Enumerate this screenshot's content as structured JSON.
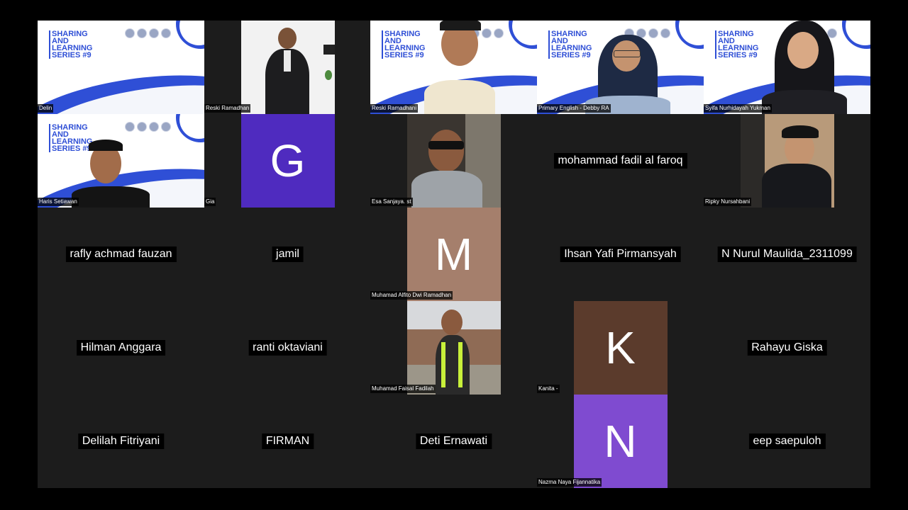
{
  "slide": {
    "title": "SHARING\nAND\nLEARNING\nSERIES #9"
  },
  "tiles": {
    "delin": "Delin",
    "reski_suit": "Reski Ramadhan",
    "reski_slide": "Reski Ramadhani",
    "debby": "Primary English - Debby RA",
    "syifa": "Syifa Nurhidayah Yukman",
    "haris": "Haris Setiawan",
    "gia": "Gia",
    "gia_avatar": "G",
    "esa": "Esa Sanjaya. st",
    "fadil": "mohammad fadil al faroq",
    "ripky": "Ripky Nursahbani",
    "rafly": "rafly achmad fauzan",
    "jamil": "jamil",
    "alfito": "Muhamad Alfito Dwi Ramadhan",
    "alfito_avatar": "M",
    "ihsan": "Ihsan Yafi Pirmansyah",
    "nurul": "N Nurul Maulida_2311099",
    "hilman": "Hilman Anggara",
    "ranti": "ranti oktaviani",
    "faisal": "Muhamad Faisal Fadilah",
    "kanita": "Kanita -",
    "kanita_avatar": "K",
    "rahayu": "Rahayu Giska",
    "delilah": "Delilah Fitriyani",
    "firman": "FIRMAN",
    "deti": "Deti Ernawati",
    "nazma": "Nazma Naya Fijannatika",
    "nazma_avatar": "N",
    "eep": "eep saepuloh"
  },
  "colors": {
    "gia": "#4f2bbf",
    "alfito": "#a57f6c",
    "kanita": "#5b3b2c",
    "nazma": "#7f4bd0",
    "slide_accent": "#2f4fd6"
  }
}
